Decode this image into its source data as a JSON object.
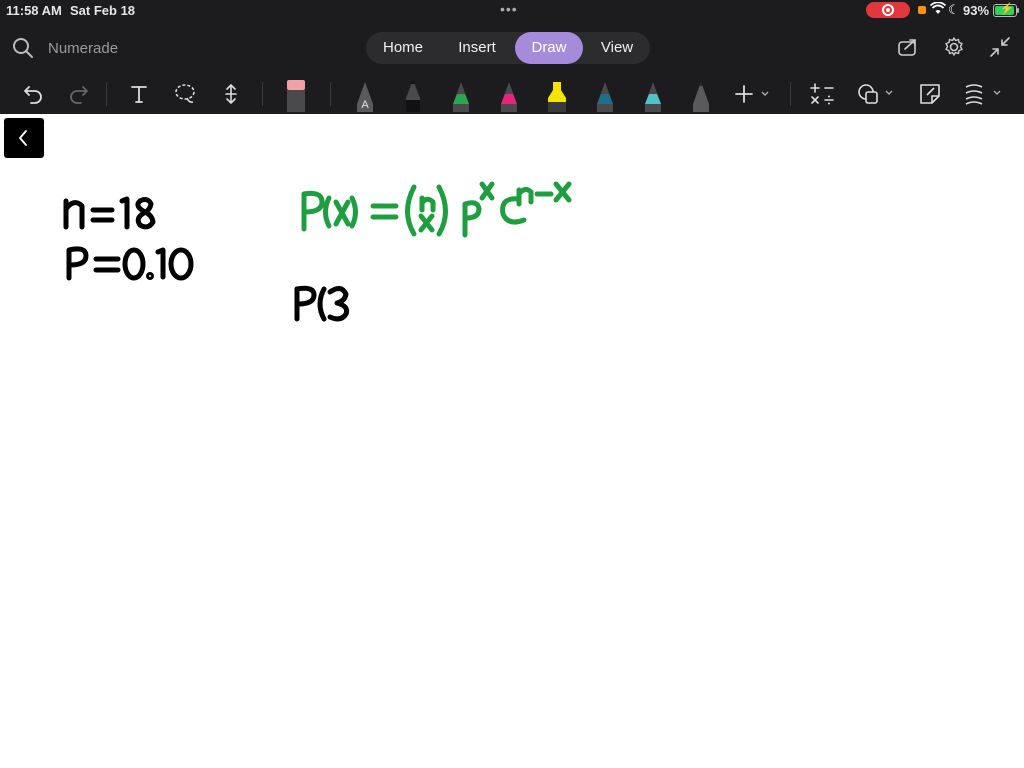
{
  "status_bar": {
    "time": "11:58 AM",
    "date": "Sat Feb 18",
    "battery_percent": "93%",
    "battery_level": 0.93,
    "recording": true
  },
  "search": {
    "placeholder": "Numerade"
  },
  "tabs": [
    {
      "label": "Home",
      "active": false
    },
    {
      "label": "Insert",
      "active": false
    },
    {
      "label": "Draw",
      "active": true
    },
    {
      "label": "View",
      "active": false
    }
  ],
  "header_icons": [
    "share-icon",
    "gear-icon",
    "collapse-icon"
  ],
  "toolbar": {
    "tools": [
      "undo-icon",
      "redo-icon",
      "text-tool-icon",
      "lasso-icon",
      "insert-space-icon",
      "eraser-icon",
      "pen-icon",
      "pen-icon",
      "pen-icon",
      "pen-icon",
      "highlighter-icon",
      "pen-icon",
      "pen-icon",
      "pen-icon",
      "add-pen-icon",
      "math-icon",
      "shapes-icon",
      "sticky-note-icon",
      "ruler-icon"
    ],
    "pen_colors": [
      "#8e8e93",
      "#2b2b2b",
      "#2ea44f",
      "#e8237a",
      "#f5e400",
      "#1f6f8b",
      "#4fc3c9",
      "#5a5a5a"
    ],
    "accent": "#a78bdb"
  },
  "canvas": {
    "ink": {
      "n_value": "n=18",
      "p_value": "P=0.10",
      "formula": "P(x)=(n x) p^x q^(n-x)",
      "partial": "P(3"
    },
    "ink_colors": {
      "black": "#000000",
      "green": "#1f9e3f"
    }
  }
}
